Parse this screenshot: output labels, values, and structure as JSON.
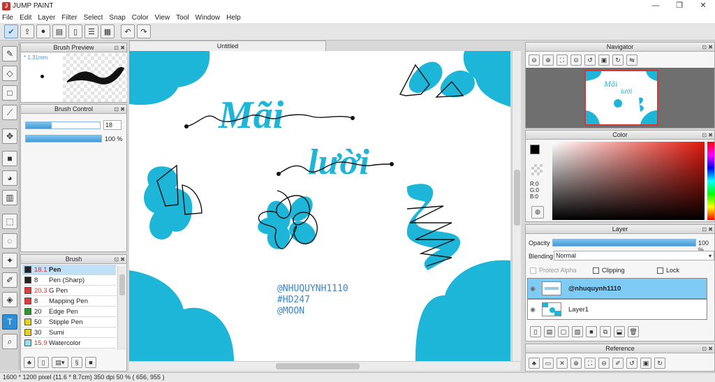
{
  "app": {
    "title": "JUMP PAINT",
    "logo": "J"
  },
  "window": {
    "minimize": "—",
    "maximize": "❐",
    "close": "✕"
  },
  "menu": [
    "File",
    "Edit",
    "Layer",
    "Filter",
    "Select",
    "Snap",
    "Color",
    "View",
    "Tool",
    "Window",
    "Help"
  ],
  "toolbar": {
    "icons": [
      "check-icon",
      "export-icon",
      "speech-bubble-icon",
      "comment-icon",
      "page-icon",
      "list-icon",
      "grid-layout-icon"
    ],
    "undo": "↶",
    "redo": "↷"
  },
  "brush_preview": {
    "title": "Brush Preview",
    "size_label": "* 1.31mm"
  },
  "brush_control": {
    "title": "Brush Control",
    "size_value": "18",
    "size_fill": 0.35,
    "opacity_label": "100 %",
    "opacity_fill": 1.0
  },
  "brush_panel": {
    "title": "Brush",
    "items": [
      {
        "size": "18.1",
        "name": "Pen",
        "color": "#222222",
        "red": true,
        "selected": true
      },
      {
        "size": "8",
        "name": "Pen (Sharp)",
        "color": "#222222",
        "red": false
      },
      {
        "size": "20.3",
        "name": "G Pen",
        "color": "#e03a3a",
        "red": true
      },
      {
        "size": "8",
        "name": "Mapping Pen",
        "color": "#e03a3a",
        "red": false
      },
      {
        "size": "20",
        "name": "Edge Pen",
        "color": "#2a9a2a",
        "red": false
      },
      {
        "size": "50",
        "name": "Stipple Pen",
        "color": "#e6d21a",
        "red": false
      },
      {
        "size": "30",
        "name": "Sumi",
        "color": "#e6d21a",
        "red": false
      },
      {
        "size": "15.9",
        "name": "Watercolor",
        "color": "#8fe0f5",
        "red": true
      }
    ]
  },
  "canvas": {
    "tab_title": "Untitled",
    "text_title1": "Mãi",
    "text_title2": "lười",
    "credit1": "@NHUQUYNH1110",
    "credit2": "#HD247",
    "credit3": "@MOON",
    "accent": "#1eb6d8"
  },
  "navigator": {
    "title": "Navigator"
  },
  "color_panel": {
    "title": "Color",
    "r": "R:0",
    "g": "G:0",
    "b": "B:0"
  },
  "layer_panel": {
    "title": "Layer",
    "opacity_label": "Opacity",
    "opacity_value": "100 %",
    "blending_label": "Blending",
    "blending_value": "Normal",
    "protect_alpha": "Protect Alpha",
    "clipping": "Clipping",
    "lock": "Lock",
    "layers": [
      {
        "name": "@nhuquynh1110",
        "selected": true
      },
      {
        "name": "Layer1",
        "selected": false
      }
    ]
  },
  "reference": {
    "title": "Reference"
  },
  "status": {
    "text": "1600 * 1200 pixel   (11.6 * 8.7cm)  350 dpi   50 %   ( 656, 955 )"
  }
}
